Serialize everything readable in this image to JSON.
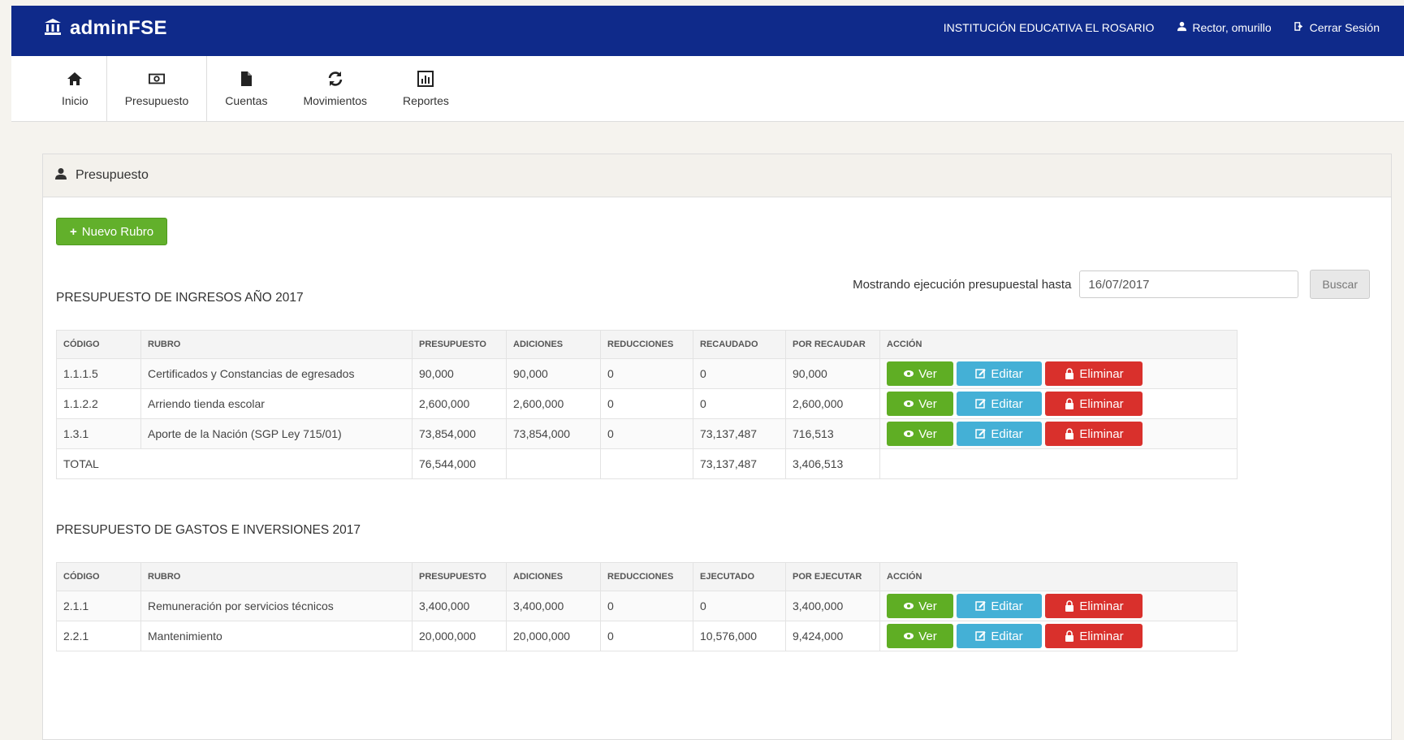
{
  "app": {
    "brand": "adminFSE",
    "institution": "INSTITUCIÓN EDUCATIVA EL ROSARIO",
    "user": "Rector, omurillo",
    "logout": "Cerrar Sesión"
  },
  "nav": [
    {
      "label": "Inicio",
      "icon": "home-icon"
    },
    {
      "label": "Presupuesto",
      "icon": "money-icon"
    },
    {
      "label": "Cuentas",
      "icon": "file-icon"
    },
    {
      "label": "Movimientos",
      "icon": "refresh-icon"
    },
    {
      "label": "Reportes",
      "icon": "chart-icon"
    }
  ],
  "panel": {
    "title": "Presupuesto",
    "new_button": "Nuevo Rubro",
    "filter_label": "Mostrando ejecución presupuestal hasta",
    "filter_date": "16/07/2017",
    "search_button": "Buscar"
  },
  "actions": {
    "view": "Ver",
    "edit": "Editar",
    "delete": "Eliminar"
  },
  "ingresos": {
    "title": "PRESUPUESTO DE INGRESOS AÑO 2017",
    "headers": [
      "CÓDIGO",
      "RUBRO",
      "PRESUPUESTO",
      "ADICIONES",
      "REDUCCIONES",
      "RECAUDADO",
      "POR RECAUDAR",
      "ACCIÓN"
    ],
    "rows": [
      [
        "1.1.1.5",
        "Certificados y Constancias de egresados",
        "90,000",
        "90,000",
        "0",
        "0",
        "90,000"
      ],
      [
        "1.1.2.2",
        "Arriendo tienda escolar",
        "2,600,000",
        "2,600,000",
        "0",
        "0",
        "2,600,000"
      ],
      [
        "1.3.1",
        "Aporte de la Nación (SGP Ley 715/01)",
        "73,854,000",
        "73,854,000",
        "0",
        "73,137,487",
        "716,513"
      ]
    ],
    "total": {
      "label": "TOTAL",
      "presupuesto": "76,544,000",
      "recaudado": "73,137,487",
      "por_recaudar": "3,406,513"
    }
  },
  "gastos": {
    "title": "PRESUPUESTO DE GASTOS E INVERSIONES 2017",
    "headers": [
      "CÓDIGO",
      "RUBRO",
      "PRESUPUESTO",
      "ADICIONES",
      "REDUCCIONES",
      "EJECUTADO",
      "POR EJECUTAR",
      "ACCIÓN"
    ],
    "rows": [
      [
        "2.1.1",
        "Remuneración por servicios técnicos",
        "3,400,000",
        "3,400,000",
        "0",
        "0",
        "3,400,000"
      ],
      [
        "2.2.1",
        "Mantenimiento",
        "20,000,000",
        "20,000,000",
        "0",
        "10,576,000",
        "9,424,000"
      ]
    ]
  }
}
